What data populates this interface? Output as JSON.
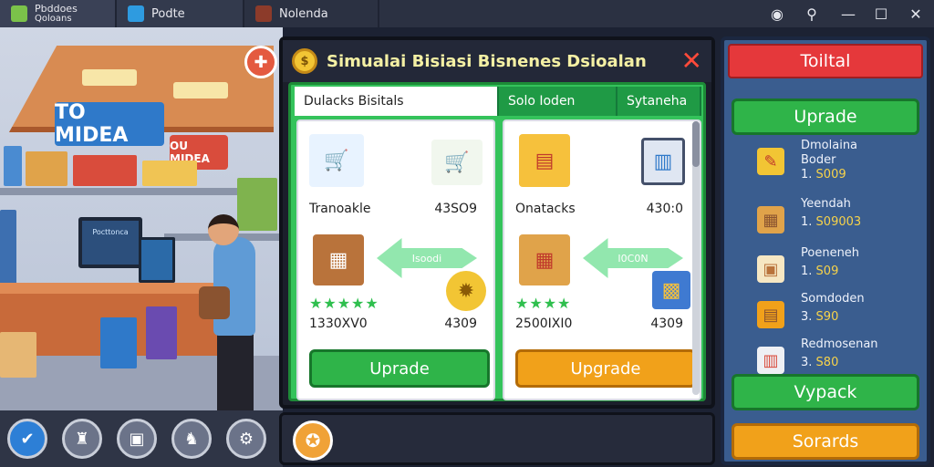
{
  "topbar": {
    "tabs": [
      {
        "label": "Pbddoes",
        "sub": "Qoloans"
      },
      {
        "label": "Podte"
      },
      {
        "label": "Nolenda"
      }
    ],
    "window_controls": [
      "record-icon",
      "pin-icon",
      "minimize-icon",
      "maximize-icon",
      "close-icon"
    ]
  },
  "scene": {
    "sign_main": "TO MIDEA",
    "sign_secondary": "OU MIDEA",
    "monitor_text": "Pocttonca"
  },
  "bottom_icons": [
    "check-icon",
    "trophy-icon",
    "box-icon",
    "knight-icon",
    "gear-icon"
  ],
  "dialog": {
    "title": "Simualai Bisiasi Bisnenes Dsioalan",
    "tabs": [
      "Dulacks Bisitals",
      "Solo Ioden",
      "Sytaneha"
    ],
    "cards": [
      {
        "name": "Tranoakle",
        "price": "43SO9",
        "arrow_label": "Isoodi",
        "stars": "★★★★★",
        "stats": "1330XV0",
        "price2": "4309",
        "button": "Uprade",
        "button_color": "green"
      },
      {
        "name": "Onatacks",
        "price": "430:0",
        "arrow_label": "I0C0N",
        "stars": "★★★★",
        "stats": "2500IXI0",
        "price2": "4309",
        "button": "Upgrade",
        "button_color": "orange"
      }
    ]
  },
  "right_panel": {
    "title": "Toiltal",
    "top_button": "Uprade",
    "items": [
      {
        "name": "Dmolaina",
        "sub": "Boder",
        "val_prefix": "1.",
        "val": "S009",
        "icon": "pencil-icon"
      },
      {
        "name": "Yeendah",
        "sub": "",
        "val_prefix": "1.",
        "val": "S09003",
        "icon": "crate-icon"
      },
      {
        "name": "Poeneneh",
        "sub": "",
        "val_prefix": "1.",
        "val": "S09",
        "icon": "box-icon"
      },
      {
        "name": "Somdoden",
        "sub": "",
        "val_prefix": "3.",
        "val": "S90",
        "icon": "gift-icon"
      },
      {
        "name": "Redmosenan",
        "sub": "",
        "val_prefix": "3.",
        "val": "S80",
        "icon": "package-icon"
      }
    ],
    "middle_button": "Vypack",
    "bottom_button": "Sorards"
  },
  "colors": {
    "dialog_green": "#34c35b",
    "button_green": "#2fb449",
    "button_orange": "#f1a11a",
    "panel_blue": "#3a5d8f",
    "panel_title_red": "#e5383b",
    "title_text": "#f4f0a4"
  }
}
